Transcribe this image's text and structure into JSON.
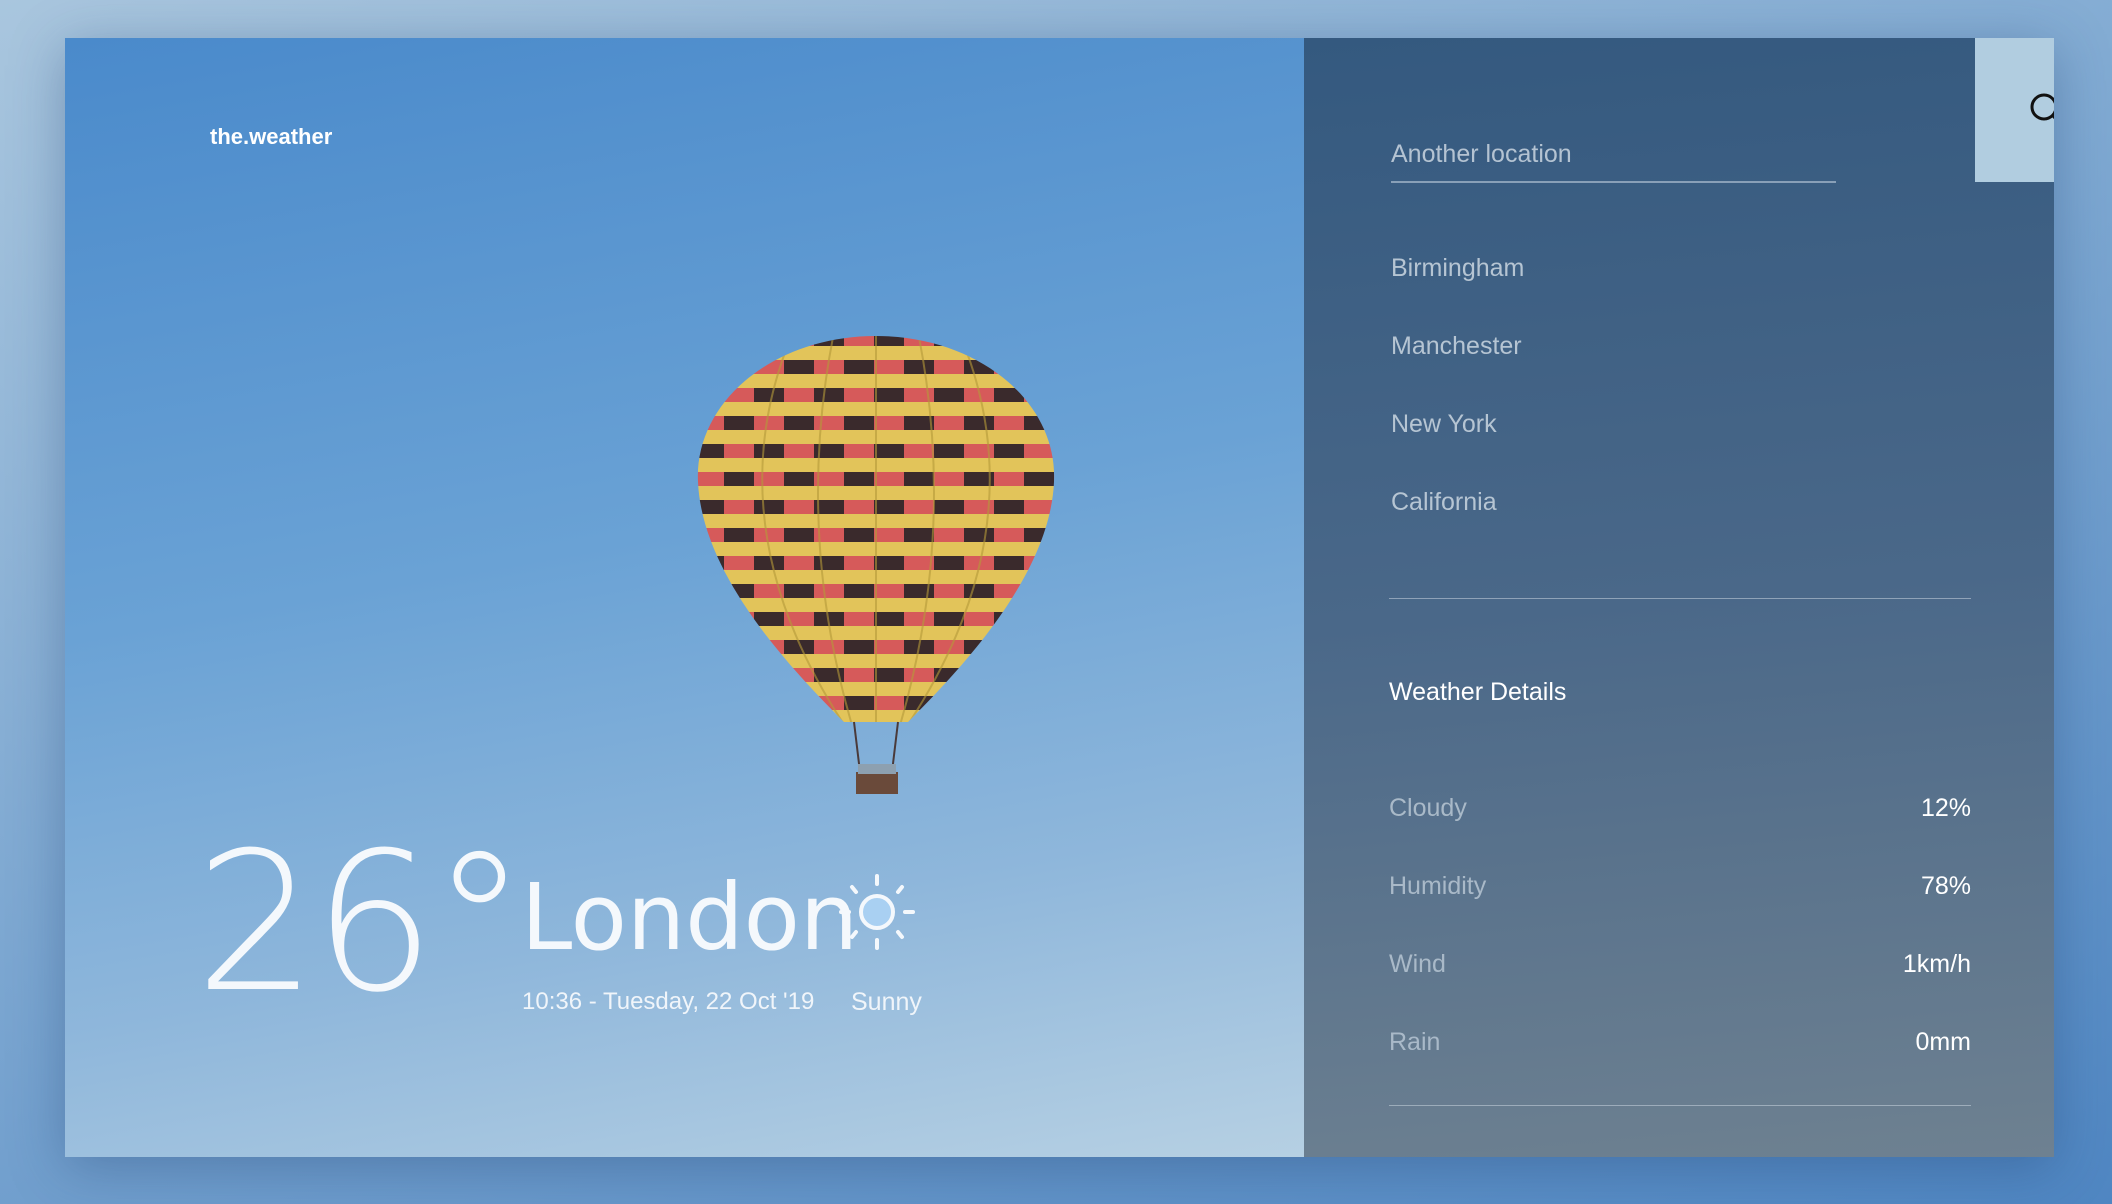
{
  "brand": "the.weather",
  "current": {
    "temperature": "26°",
    "city": "London",
    "datetime": "10:36 - Tuesday, 22 Oct '19",
    "condition": "Sunny",
    "condition_icon": "sun-icon"
  },
  "search": {
    "placeholder": "Another location",
    "icon": "search-icon"
  },
  "locations": [
    "Birmingham",
    "Manchester",
    "New York",
    "California"
  ],
  "details": {
    "title": "Weather Details",
    "rows": [
      {
        "label": "Cloudy",
        "value": "12%"
      },
      {
        "label": "Humidity",
        "value": "78%"
      },
      {
        "label": "Wind",
        "value": "1km/h"
      },
      {
        "label": "Rain",
        "value": "0mm"
      }
    ]
  },
  "colors": {
    "accent": "#b1cde0",
    "panel": "#34597f",
    "sky": "#4a8acb"
  }
}
